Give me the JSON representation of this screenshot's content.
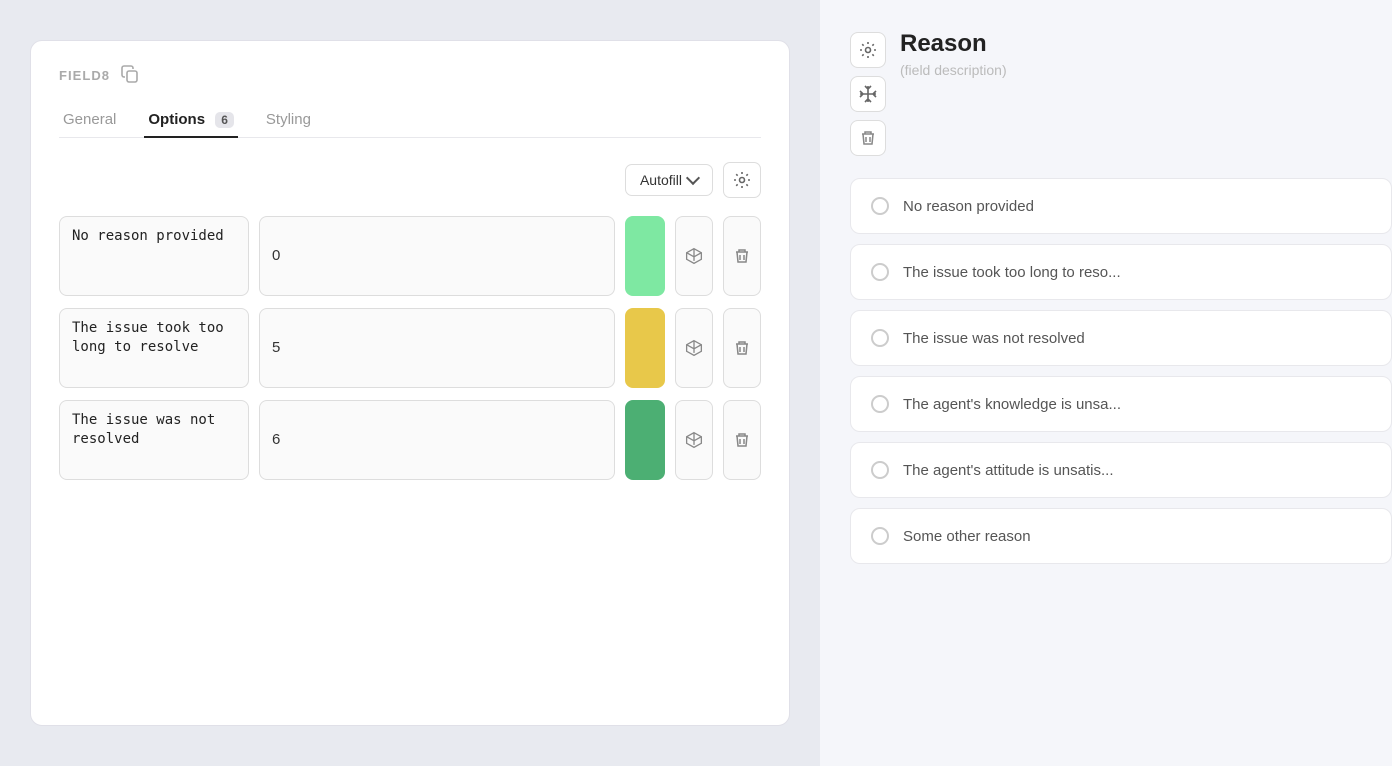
{
  "left_panel": {
    "field_label": "FIELD8",
    "tabs": [
      {
        "id": "general",
        "label": "General",
        "active": false
      },
      {
        "id": "options",
        "label": "Options",
        "active": true,
        "badge": "6"
      },
      {
        "id": "styling",
        "label": "Styling",
        "active": false
      }
    ],
    "autofill_button": "Autofill",
    "options": [
      {
        "text": "No reason provided",
        "value": "0",
        "color": "green-light"
      },
      {
        "text": "The issue took too long to resolve",
        "value": "5",
        "color": "yellow"
      },
      {
        "text": "The issue was not resolved",
        "value": "6",
        "color": "green"
      }
    ]
  },
  "right_panel": {
    "title": "Reason",
    "subtitle": "(field description)",
    "radio_options": [
      {
        "label": "No reason provided"
      },
      {
        "label": "The issue took too long to reso..."
      },
      {
        "label": "The issue was not resolved"
      },
      {
        "label": "The agent's knowledge is unsa..."
      },
      {
        "label": "The agent's attitude is unsatis..."
      },
      {
        "label": "Some other reason"
      }
    ]
  },
  "icons": {
    "gear": "⚙",
    "copy": "⧉",
    "cube": "⬡",
    "trash": "🗑",
    "move": "✥",
    "chevron": "▾",
    "settings": "⚙"
  }
}
